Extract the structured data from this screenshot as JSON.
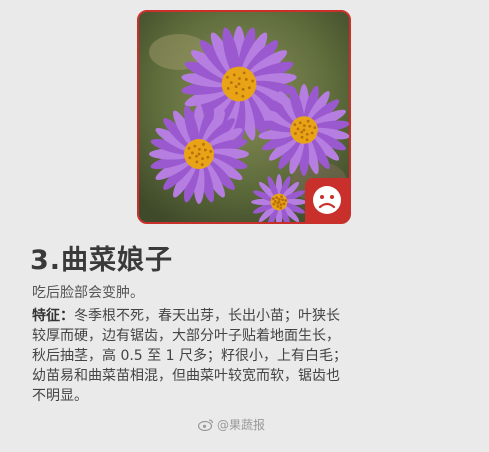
{
  "title": "3.曲菜娘子",
  "subtitle": "吃后脸部会变肿。",
  "features": {
    "label": "特征：",
    "lines": [
      "冬季根不死，春天出芽，长出小苗；叶狭长",
      "较厚而硬，边有锯齿，大部分叶子贴着地面生长，",
      "秋后抽茎，高 0.5 至 1 尺多；籽很小，上有白毛；",
      "幼苗易和曲菜苗相混，但曲菜叶较宽而软，锯齿也",
      "不明显。"
    ]
  },
  "watermark": {
    "text": "@果蔬报",
    "icon": "weibo-icon"
  },
  "badge": {
    "icon": "sad-face-icon"
  },
  "colors": {
    "accent": "#c9302c",
    "petal": "#9b59d0",
    "center": "#e8a317"
  }
}
